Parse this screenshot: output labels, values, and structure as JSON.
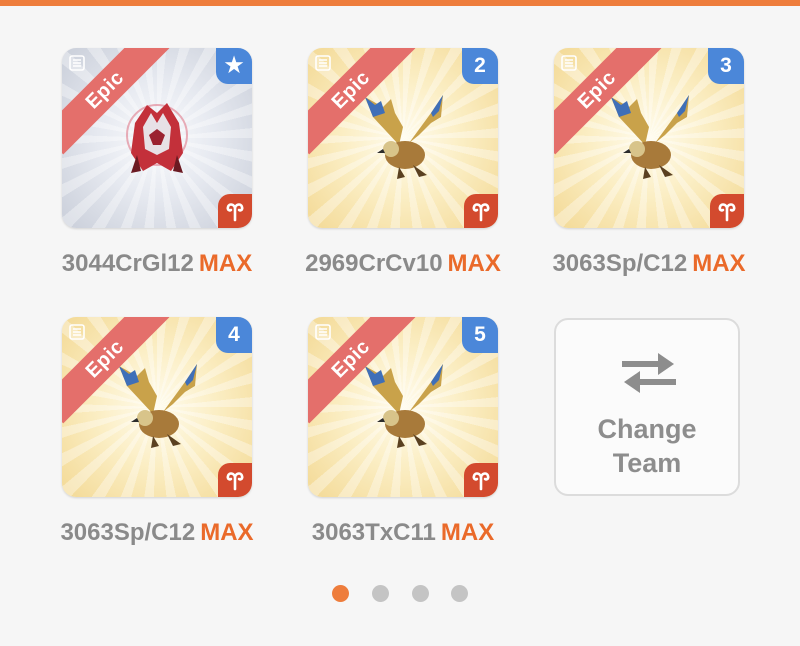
{
  "colors": {
    "accent": "#ee7d3c",
    "rarity_ribbon": "#e46f6b",
    "slot_badge": "#4b87d9",
    "element_badge": "#d34a2e",
    "max_text": "#ea6a2a"
  },
  "team": [
    {
      "rarity": "Epic",
      "slot": "★",
      "slot_icon": "star-icon",
      "element_icon": "aries-icon",
      "creature": "red-crystal-golem",
      "name": "3044CrGl12",
      "level": "MAX"
    },
    {
      "rarity": "Epic",
      "slot": "2",
      "element_icon": "aries-icon",
      "creature": "gold-blue-griffin",
      "name": "2969CrCv10",
      "level": "MAX"
    },
    {
      "rarity": "Epic",
      "slot": "3",
      "element_icon": "aries-icon",
      "creature": "gold-blue-griffin",
      "name": "3063Sp/C12",
      "level": "MAX"
    },
    {
      "rarity": "Epic",
      "slot": "4",
      "element_icon": "aries-icon",
      "creature": "gold-blue-griffin",
      "name": "3063Sp/C12",
      "level": "MAX"
    },
    {
      "rarity": "Epic",
      "slot": "5",
      "element_icon": "aries-icon",
      "creature": "gold-blue-griffin",
      "name": "3063TxC11",
      "level": "MAX"
    }
  ],
  "change_team": {
    "icon": "swap-arrows-icon",
    "line1": "Change",
    "line2": "Team"
  },
  "pagination": {
    "pages": 4,
    "active": 1
  }
}
